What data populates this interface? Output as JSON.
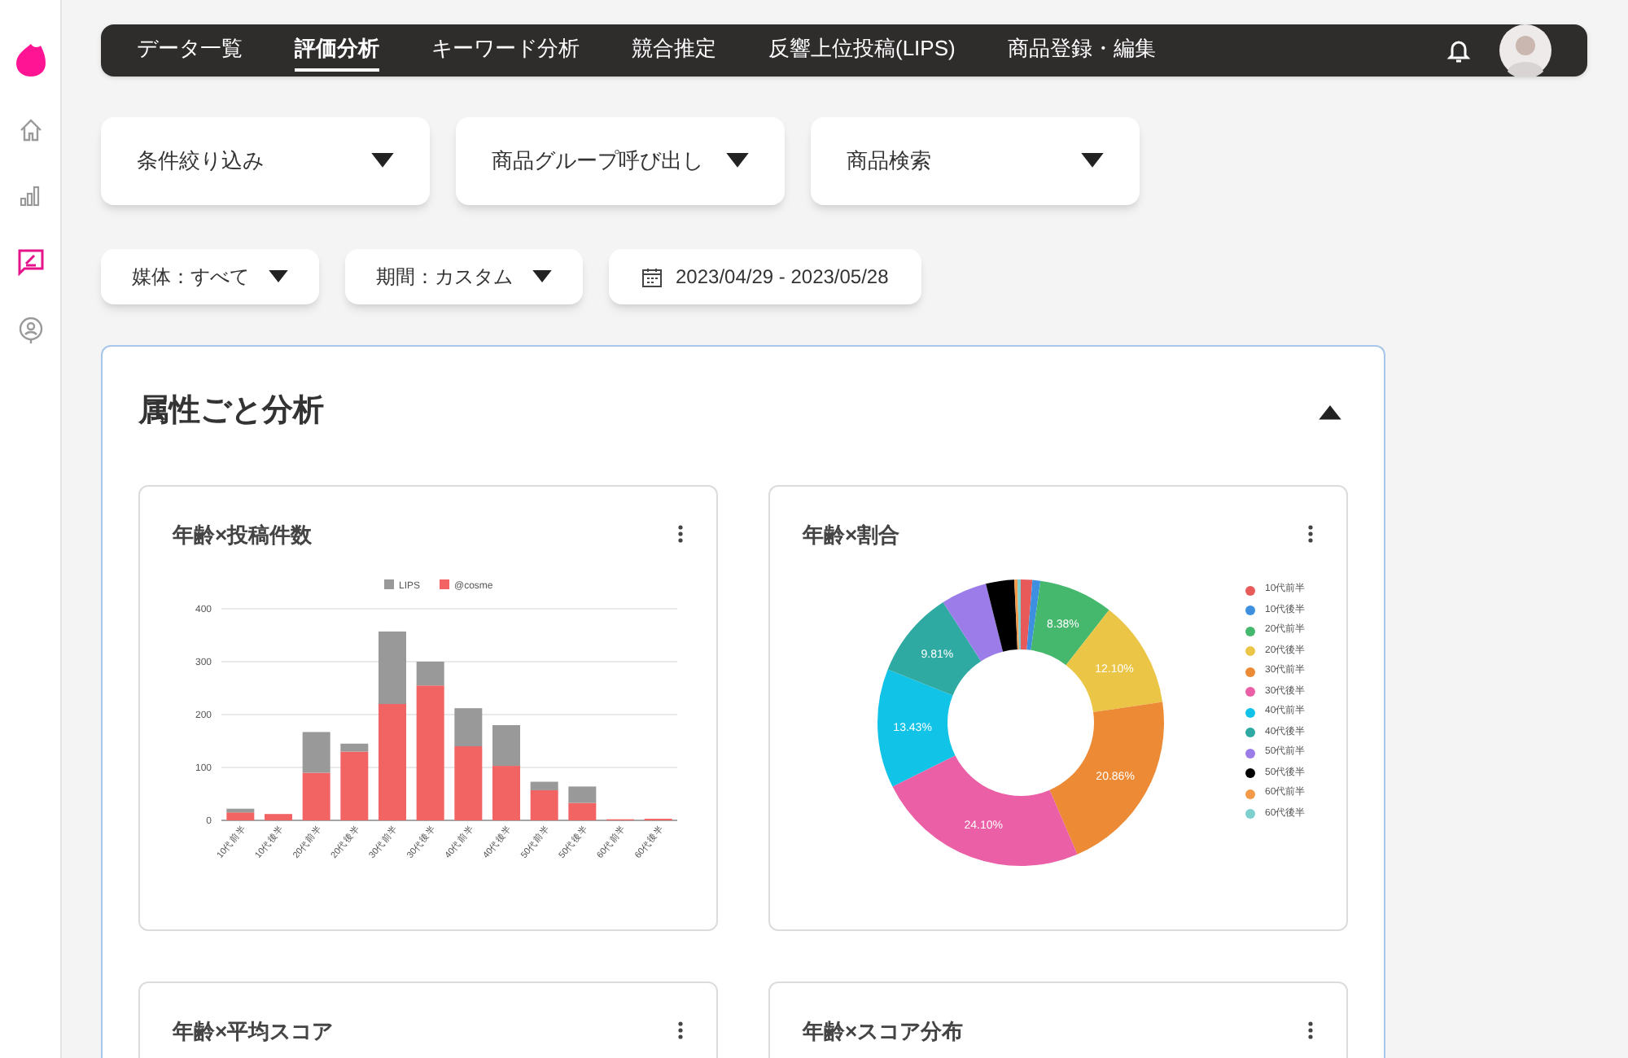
{
  "sidebar": {
    "items": [
      {
        "kind": "logo",
        "selected": false
      },
      {
        "kind": "home",
        "selected": false
      },
      {
        "kind": "chart",
        "selected": false
      },
      {
        "kind": "review",
        "selected": true
      },
      {
        "kind": "user",
        "selected": false
      }
    ]
  },
  "nav": {
    "tabs": [
      {
        "label": "データ一覧",
        "selected": false
      },
      {
        "label": "評価分析",
        "selected": true
      },
      {
        "label": "キーワード分析",
        "selected": false
      },
      {
        "label": "競合推定",
        "selected": false
      },
      {
        "label": "反響上位投稿(LIPS)",
        "selected": false
      },
      {
        "label": "商品登録・編集",
        "selected": false
      }
    ]
  },
  "filters": [
    {
      "label": "条件絞り込み"
    },
    {
      "label": "商品グループ呼び出し"
    },
    {
      "label": "商品検索"
    }
  ],
  "pills": [
    {
      "kind": "dropdown",
      "label": "媒体：すべて"
    },
    {
      "kind": "dropdown",
      "label": "期間：カスタム"
    },
    {
      "kind": "date",
      "label": "2023/04/29 - 2023/05/28"
    }
  ],
  "section": {
    "title": "属性ごと分析",
    "expanded": true,
    "cards": [
      {
        "title": "年齢×投稿件数",
        "chart_data": {
          "type": "bar",
          "stacked": true,
          "categories": [
            "10代前半",
            "10代後半",
            "20代前半",
            "20代後半",
            "30代前半",
            "30代後半",
            "40代前半",
            "40代後半",
            "50代前半",
            "50代後半",
            "60代前半",
            "60代後半"
          ],
          "series": [
            {
              "name": "LIPS",
              "color": "#999999",
              "values": [
                7,
                null,
                77,
                15,
                137,
                45,
                72,
                77,
                16,
                31,
                0,
                0
              ]
            },
            {
              "name": "@cosme",
              "color": "#f26363",
              "values": [
                15,
                12,
                90,
                130,
                220,
                255,
                140,
                103,
                57,
                33,
                2,
                3
              ]
            }
          ],
          "ylim": [
            0,
            400
          ],
          "yticks": [
            0,
            100,
            200,
            300,
            400
          ],
          "grid": true,
          "legend": true
        }
      },
      {
        "title": "年齢×割合",
        "chart_data": {
          "type": "donut",
          "legend": true,
          "value_labels": [
            null,
            null,
            "8.38%",
            "12.10%",
            "20.86%",
            "24.10%",
            "13.43%",
            "9.81%",
            null,
            null,
            null,
            null
          ],
          "categories": [
            "10代前半",
            "10代後半",
            "20代前半",
            "20代後半",
            "30代前半",
            "30代後半",
            "40代前半",
            "40代後半",
            "50代前半",
            "50代後半",
            "60代前半",
            "60代後半"
          ],
          "series": [
            {
              "colors": [
                "#e85a5a",
                "#3d8fe0",
                "#46b86e",
                "#ebc545",
                "#ec8a35",
                "#ea5fa5",
                "#12c3e8",
                "#2eaaa3",
                "#9b7ce8",
                "#000000",
                "#f29a4a",
                "#7ecfcf"
              ],
              "values": [
                1.3,
                0.9,
                8.38,
                12.1,
                20.86,
                24.1,
                13.43,
                9.81,
                5.2,
                3.2,
                0.35,
                0.37
              ]
            }
          ]
        }
      },
      {
        "title": "年齢×平均スコア"
      },
      {
        "title": "年齢×スコア分布"
      }
    ]
  }
}
